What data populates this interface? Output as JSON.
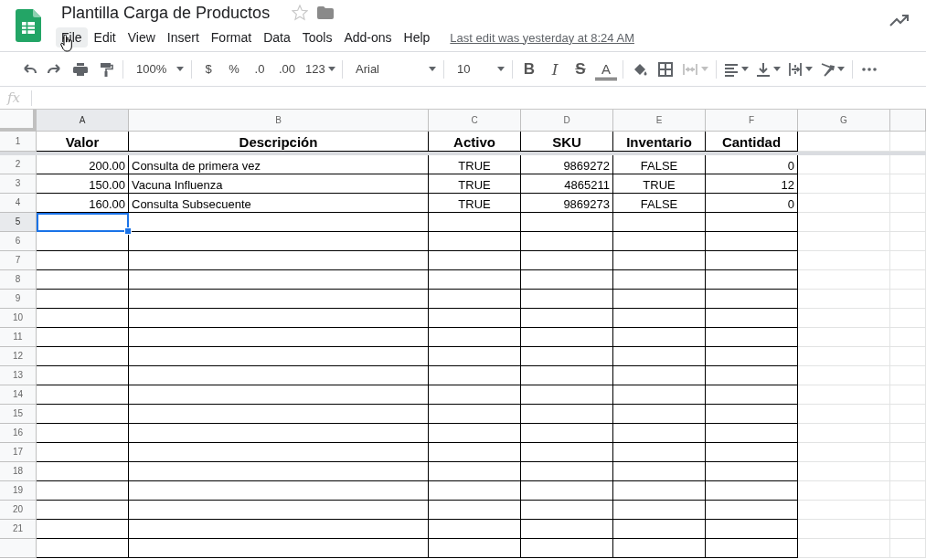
{
  "document": {
    "title": "Plantilla Carga de Productos",
    "starred": false
  },
  "menu": [
    {
      "label": "File",
      "hovered": true
    },
    {
      "label": "Edit",
      "hovered": false
    },
    {
      "label": "View",
      "hovered": false
    },
    {
      "label": "Insert",
      "hovered": false
    },
    {
      "label": "Format",
      "hovered": false
    },
    {
      "label": "Data",
      "hovered": false
    },
    {
      "label": "Tools",
      "hovered": false
    },
    {
      "label": "Add-ons",
      "hovered": false
    },
    {
      "label": "Help",
      "hovered": false
    }
  ],
  "last_edit": "Last edit was yesterday at 8:24 AM",
  "toolbar": {
    "zoom": "100%",
    "currency": "$",
    "percent": "%",
    "decrease_decimals": ".0",
    "increase_decimals": ".00",
    "more_formats": "123",
    "font": "Arial",
    "font_size": "10",
    "text_styles": [
      {
        "label": "B",
        "kind": "bold"
      },
      {
        "label": "I",
        "kind": "italic"
      },
      {
        "label": "S",
        "kind": "strike"
      },
      {
        "label": "A",
        "kind": "color"
      }
    ],
    "merge_disabled": true
  },
  "formula_bar": {
    "label": "fx"
  },
  "sheet": {
    "columns": [
      {
        "letter": "A",
        "kind": "number",
        "selected": true
      },
      {
        "letter": "B",
        "kind": "text",
        "selected": false
      },
      {
        "letter": "C",
        "kind": "boolean",
        "selected": false
      },
      {
        "letter": "D",
        "kind": "number",
        "selected": false
      },
      {
        "letter": "E",
        "kind": "boolean",
        "selected": false
      },
      {
        "letter": "F",
        "kind": "number",
        "selected": false
      },
      {
        "letter": "G",
        "kind": "empty",
        "selected": false
      }
    ],
    "rows": [
      {
        "number": "1",
        "selected": false,
        "header": true,
        "cells": [
          "Valor",
          "Descripción",
          "Activo",
          "SKU",
          "Inventario",
          "Cantidad"
        ]
      },
      {
        "number": "2",
        "selected": false,
        "cells": [
          "200.00",
          "Consulta de primera vez",
          "TRUE",
          "9869272",
          "FALSE",
          "0"
        ]
      },
      {
        "number": "3",
        "selected": false,
        "cells": [
          "150.00",
          "Vacuna Influenza",
          "TRUE",
          "4865211",
          "TRUE",
          "12"
        ]
      },
      {
        "number": "4",
        "selected": false,
        "cells": [
          "160.00",
          "Consulta Subsecuente",
          "TRUE",
          "9869273",
          "FALSE",
          "0"
        ]
      },
      {
        "number": "5",
        "selected": true
      },
      {
        "number": "6",
        "selected": false
      },
      {
        "number": "7",
        "selected": false
      },
      {
        "number": "8",
        "selected": false
      },
      {
        "number": "9",
        "selected": false
      },
      {
        "number": "10",
        "selected": false
      },
      {
        "number": "11",
        "selected": false
      },
      {
        "number": "12",
        "selected": false
      },
      {
        "number": "13",
        "selected": false
      },
      {
        "number": "14",
        "selected": false
      },
      {
        "number": "15",
        "selected": false
      },
      {
        "number": "16",
        "selected": false
      },
      {
        "number": "17",
        "selected": false
      },
      {
        "number": "18",
        "selected": false
      },
      {
        "number": "19",
        "selected": false
      },
      {
        "number": "20",
        "selected": false
      },
      {
        "number": "21",
        "selected": false
      }
    ]
  }
}
